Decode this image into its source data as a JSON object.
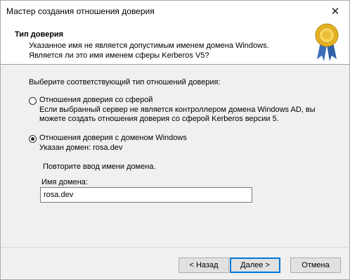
{
  "window": {
    "title": "Мастер создания отношения доверия"
  },
  "header": {
    "title": "Тип доверия",
    "line1": "Указанное имя не является допустимым именем домена Windows.",
    "line2": "Является ли это имя именем сферы Kerberos V5?",
    "icon": "seal-ribbon-icon"
  },
  "prompt": "Выберите соответствующий тип отношений доверия:",
  "options": [
    {
      "label": "Отношения доверия со сферой",
      "desc1": "Если выбранный сервер не является контроллером домена Windows AD, вы",
      "desc2": "можете создать отношения доверия со сферой Kerberos версии 5.",
      "checked": false
    },
    {
      "label": "Отношения доверия с доменом Windows",
      "desc1": "Указан домен: rosa.dev",
      "checked": true
    }
  ],
  "domain_section": {
    "repeat_text": "Повторите ввод имени домена.",
    "field_label": "Имя домена:",
    "field_value": "rosa.dev"
  },
  "buttons": {
    "back": "< Назад",
    "next": "Далее >",
    "cancel": "Отмена"
  }
}
